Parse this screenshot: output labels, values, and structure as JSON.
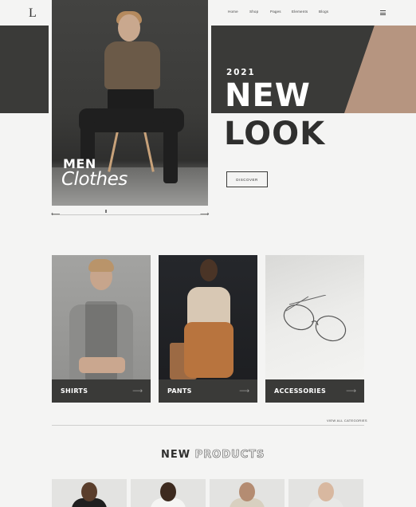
{
  "header": {
    "logo": "L",
    "nav": [
      "Home",
      "Shop",
      "Pages",
      "Elements",
      "Blogs"
    ],
    "menu_icon": "hamburger-menu-icon"
  },
  "hero": {
    "caption_line1": "MEN",
    "caption_line2": "Clothes",
    "year": "2021",
    "headline_line1": "NEW",
    "headline_line2": "LOOK",
    "cta_label": "DISCOVER",
    "prev_arrow": "⟵",
    "next_arrow": "⟶"
  },
  "categories": [
    {
      "label": "SHIRTS",
      "arrow": "⟶"
    },
    {
      "label": "PANTS",
      "arrow": "⟶"
    },
    {
      "label": "ACCESSORIES",
      "arrow": "⟶"
    }
  ],
  "view_all": "VIEW ALL CATEGORIES",
  "new_products": {
    "word1": "NEW",
    "word2": "PRODUCTS"
  },
  "colors": {
    "dark_band": "#3a3a38",
    "accent_tan": "#b69580",
    "background": "#f4f4f3"
  }
}
